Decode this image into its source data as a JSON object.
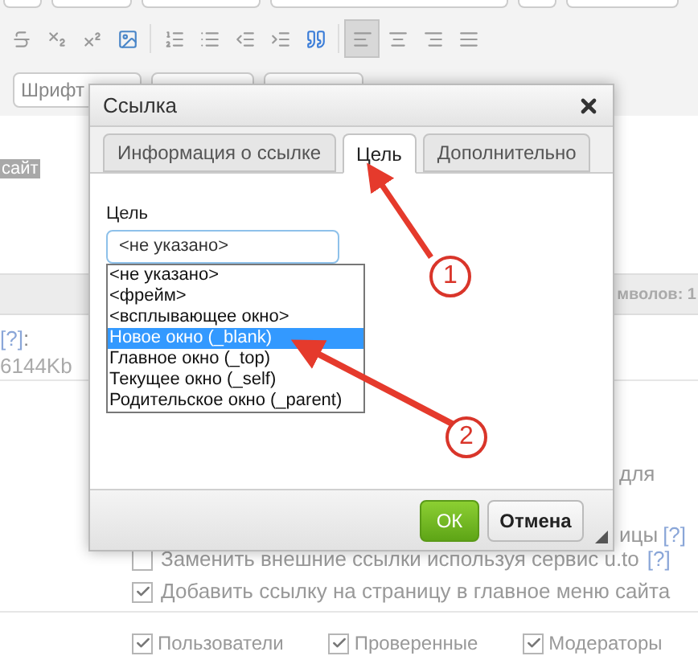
{
  "editor": {
    "toolbar": [
      {
        "kind": "strikethrough",
        "selected": false
      },
      {
        "kind": "subscript",
        "selected": false
      },
      {
        "kind": "superscript",
        "selected": false
      },
      {
        "kind": "image",
        "selected": false
      },
      {
        "kind": "numbered-list",
        "selected": false
      },
      {
        "kind": "bullet-list",
        "selected": false
      },
      {
        "kind": "outdent",
        "selected": false
      },
      {
        "kind": "indent",
        "selected": false
      },
      {
        "kind": "quote",
        "selected": false
      },
      {
        "kind": "align-left",
        "selected": true
      },
      {
        "kind": "align-center",
        "selected": false
      },
      {
        "kind": "align-right",
        "selected": false
      },
      {
        "kind": "align-justify",
        "selected": false
      }
    ],
    "font_select": {
      "value": "Шрифт"
    },
    "tag": "сайт",
    "char_count": "мволов: 1",
    "help_link": "[?]",
    "help_suffix": ":",
    "size_limit": "6144Kb",
    "fragments": [
      {
        "text": "для"
      },
      {
        "text": "ицы",
        "help": "[?]"
      }
    ],
    "options": [
      {
        "label": "Заменить внешние ссылки используя сервис u.to",
        "checked": false,
        "help": "[?]"
      },
      {
        "label": "Добавить ссылку на страницу в главное меню сайта",
        "checked": true
      }
    ],
    "groups": [
      {
        "label": "Пользователи",
        "checked": true
      },
      {
        "label": "Проверенные",
        "checked": true
      },
      {
        "label": "Модераторы",
        "checked": true
      }
    ]
  },
  "dialog": {
    "title": "Ссылка",
    "tabs": [
      {
        "label": "Информация о ссылке",
        "selected": false
      },
      {
        "label": "Цель",
        "selected": true
      },
      {
        "label": "Дополнительно",
        "selected": false
      }
    ],
    "field_label": "Цель",
    "select": {
      "value": "<не указано>"
    },
    "dropdown_options": [
      {
        "label": "<не указано>",
        "selected": false
      },
      {
        "label": "<фрейм>",
        "selected": false
      },
      {
        "label": "<всплывающее окно>",
        "selected": false
      },
      {
        "label": "Новое окно (_blank)",
        "selected": true
      },
      {
        "label": "Главное окно (_top)",
        "selected": false
      },
      {
        "label": "Текущее окно (_self)",
        "selected": false
      },
      {
        "label": "Родительское окно (_parent)",
        "selected": false
      }
    ],
    "buttons": [
      {
        "label": "ОК",
        "kind": "primary"
      },
      {
        "label": "Отмена",
        "kind": "secondary"
      }
    ]
  },
  "annotations": [
    {
      "label": "1"
    },
    {
      "label": "2"
    }
  ]
}
